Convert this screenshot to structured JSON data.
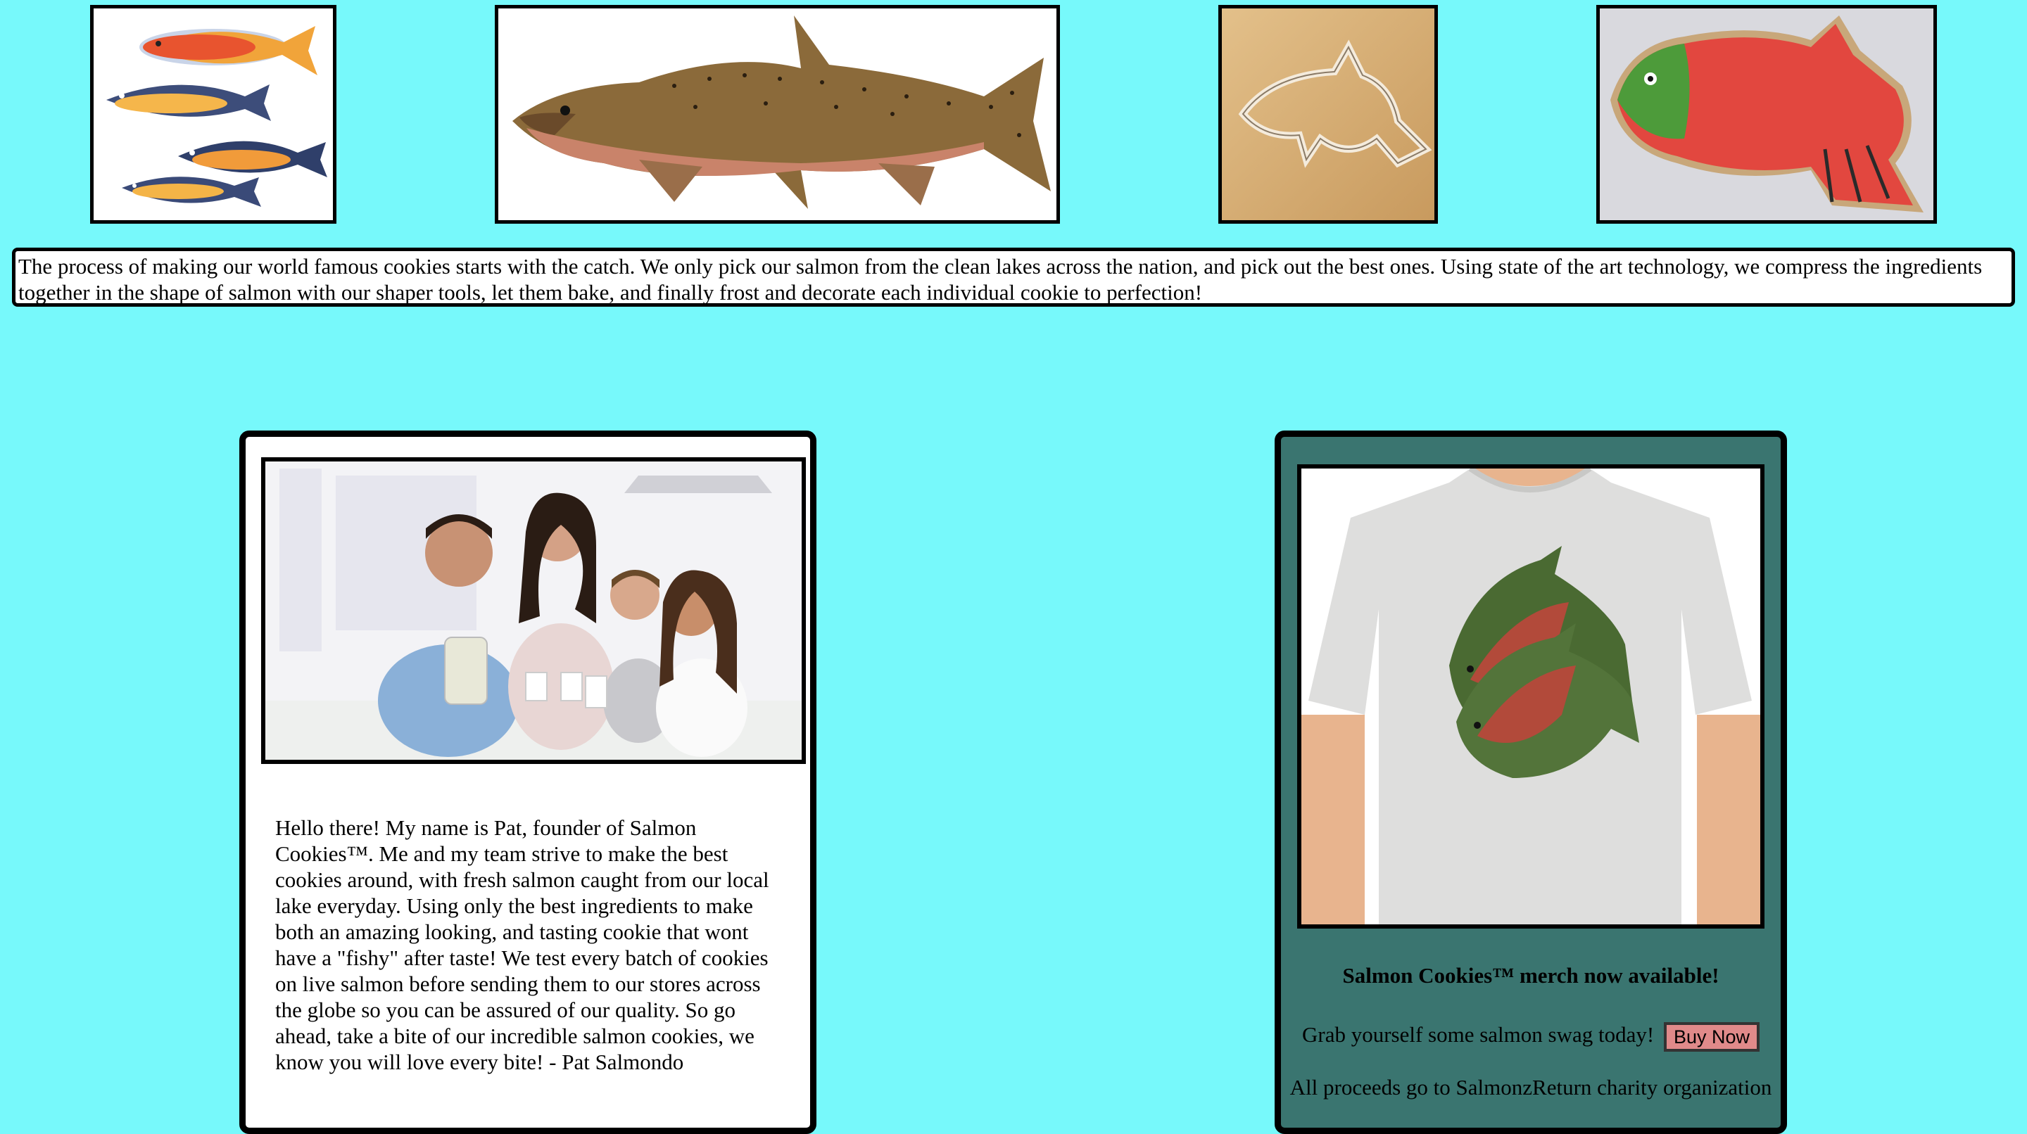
{
  "gallery": {
    "images": [
      {
        "icon": "salmon-group-illustration"
      },
      {
        "icon": "chinook-salmon-illustration"
      },
      {
        "icon": "fish-cookie-cutter-photo"
      },
      {
        "icon": "frosted-salmon-cookie-photo"
      }
    ]
  },
  "process": {
    "text": "The process of making our world famous cookies starts with the catch. We only pick our salmon from the clean lakes across the nation, and pick out the best ones. Using state of the art technology, we compress the ingredients together in the shape of salmon with our shaper tools, let them bake, and finally frost and decorate each individual cookie to perfection!"
  },
  "about": {
    "photo_icon": "family-kitchen-photo",
    "text": "Hello there! My name is Pat, founder of Salmon Cookies™. Me and my team strive to make the best cookies around, with fresh salmon caught from our local lake everyday. Using only the best ingredients to make both an amazing looking, and tasting cookie that wont have a \"fishy\" after taste! We test every batch of cookies on live salmon before sending them to our stores across the globe so you can be assured of our quality. So go ahead, take a bite of our incredible salmon cookies, we know you will love every bite! - Pat Salmondo"
  },
  "merch": {
    "photo_icon": "salmon-tshirt-photo",
    "title": "Salmon Cookies™ merch now available!",
    "swag_text": "Grab yourself some salmon swag today!",
    "buy_label": "Buy Now",
    "proceeds_text": "All proceeds go to SalmonzReturn charity organization"
  },
  "colors": {
    "page_background": "#77f9fb",
    "merch_card": "#3a7570",
    "buy_button": "#e08a8a"
  }
}
